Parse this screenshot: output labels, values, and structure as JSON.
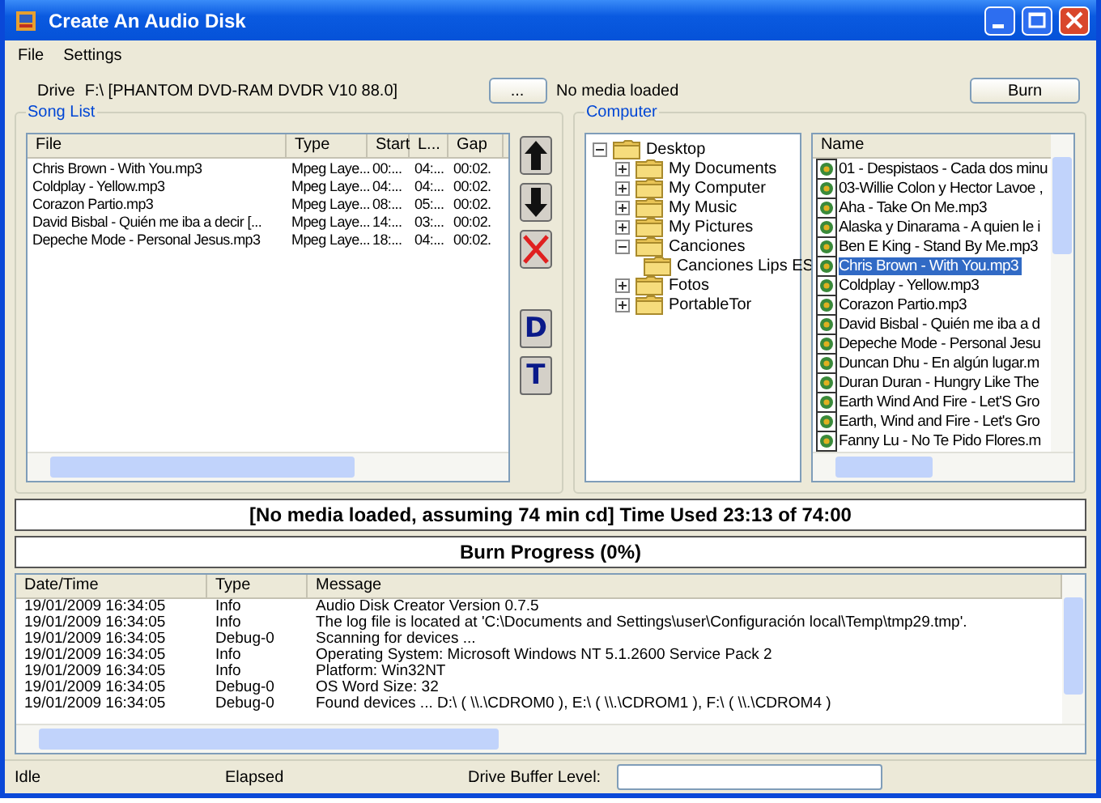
{
  "window": {
    "title": "Create An Audio Disk"
  },
  "menu": [
    "File",
    "Settings"
  ],
  "drive": {
    "label": "Drive",
    "value": "F:\\ [PHANTOM  DVD-RAM DVDR V10 88.0]",
    "browse_button": "...",
    "status": "No media loaded"
  },
  "burn_button": "Burn",
  "song_list": {
    "title": "Song List",
    "columns": [
      "File",
      "Type",
      "Start",
      "L...",
      "Gap"
    ],
    "rows": [
      {
        "cells": [
          "Chris Brown - With You.mp3",
          "Mpeg Laye...",
          "00:...",
          "04:...",
          "00:02."
        ]
      },
      {
        "cells": [
          "Coldplay - Yellow.mp3",
          "Mpeg Laye...",
          "04:...",
          "04:...",
          "00:02."
        ]
      },
      {
        "cells": [
          "Corazon Partio.mp3",
          "Mpeg Laye...",
          "08:...",
          "05:...",
          "00:02."
        ]
      },
      {
        "cells": [
          "David Bisbal - Quién me iba a decir [...",
          "Mpeg Laye...",
          "14:...",
          "03:...",
          "00:02."
        ]
      },
      {
        "cells": [
          "Depeche Mode - Personal Jesus.mp3",
          "Mpeg Laye...",
          "18:...",
          "04:...",
          "00:02."
        ]
      }
    ],
    "tools": [
      {
        "kind": "up"
      },
      {
        "kind": "down"
      },
      {
        "kind": "delete"
      },
      {
        "kind": "letter",
        "label": "D"
      },
      {
        "kind": "letter",
        "label": "T"
      }
    ]
  },
  "computer": {
    "title": "Computer",
    "tree": [
      {
        "label": "Desktop",
        "expanded": true,
        "children": [
          {
            "label": "My Documents",
            "expanded": false
          },
          {
            "label": "My Computer",
            "expanded": false
          },
          {
            "label": "My Music",
            "expanded": false
          },
          {
            "label": "My Pictures",
            "expanded": false
          },
          {
            "label": "Canciones",
            "expanded": true,
            "children": [
              {
                "label": "Canciones Lips ES"
              }
            ]
          },
          {
            "label": "Fotos",
            "expanded": false
          },
          {
            "label": "PortableTor",
            "expanded": false
          }
        ]
      }
    ],
    "files": {
      "column": "Name",
      "items": [
        {
          "name": "01 - Despistaos - Cada dos minu",
          "selected": false
        },
        {
          "name": "03-Willie Colon y Hector Lavoe ,",
          "selected": false
        },
        {
          "name": "Aha - Take On Me.mp3",
          "selected": false
        },
        {
          "name": "Alaska y Dinarama - A quien le i",
          "selected": false
        },
        {
          "name": "Ben E King - Stand By Me.mp3",
          "selected": false
        },
        {
          "name": "Chris Brown - With You.mp3",
          "selected": true
        },
        {
          "name": "Coldplay - Yellow.mp3",
          "selected": false
        },
        {
          "name": "Corazon Partio.mp3",
          "selected": false
        },
        {
          "name": "David Bisbal - Quién me iba a d",
          "selected": false
        },
        {
          "name": "Depeche Mode - Personal Jesu",
          "selected": false
        },
        {
          "name": "Duncan Dhu - En algún lugar.m",
          "selected": false
        },
        {
          "name": "Duran Duran - Hungry Like The",
          "selected": false
        },
        {
          "name": "Earth Wind And Fire - Let'S Gro",
          "selected": false
        },
        {
          "name": "Earth, Wind and Fire - Let's Gro",
          "selected": false
        },
        {
          "name": "Fanny Lu - No Te Pido Flores.m",
          "selected": false
        }
      ]
    }
  },
  "time_status": "[No media loaded, assuming 74 min cd] Time Used 23:13 of 74:00",
  "burn_progress": "Burn Progress (0%)",
  "log": {
    "columns": [
      "Date/Time",
      "Type",
      "Message"
    ],
    "rows": [
      {
        "cells": [
          "19/01/2009 16:34:05",
          "Info",
          "Audio Disk Creator Version 0.7.5"
        ]
      },
      {
        "cells": [
          "19/01/2009 16:34:05",
          "Info",
          "The log file is located at 'C:\\Documents and Settings\\user\\Configuración local\\Temp\\tmp29.tmp'."
        ]
      },
      {
        "cells": [
          "19/01/2009 16:34:05",
          "Debug-0",
          "Scanning for devices ..."
        ]
      },
      {
        "cells": [
          "19/01/2009 16:34:05",
          "Info",
          "Operating System: Microsoft Windows NT 5.1.2600 Service Pack 2"
        ]
      },
      {
        "cells": [
          "19/01/2009 16:34:05",
          "Info",
          "Platform: Win32NT"
        ]
      },
      {
        "cells": [
          "19/01/2009 16:34:05",
          "Debug-0",
          "OS Word Size: 32"
        ]
      },
      {
        "cells": [
          "19/01/2009 16:34:05",
          "Debug-0",
          "Found devices ... D:\\ ( \\\\.\\CDROM0 ), E:\\ ( \\\\.\\CDROM1 ), F:\\ ( \\\\.\\CDROM4 )"
        ]
      }
    ]
  },
  "status_bar": {
    "state": "Idle",
    "elapsed": "Elapsed",
    "buffer_label": "Drive Buffer Level:"
  }
}
